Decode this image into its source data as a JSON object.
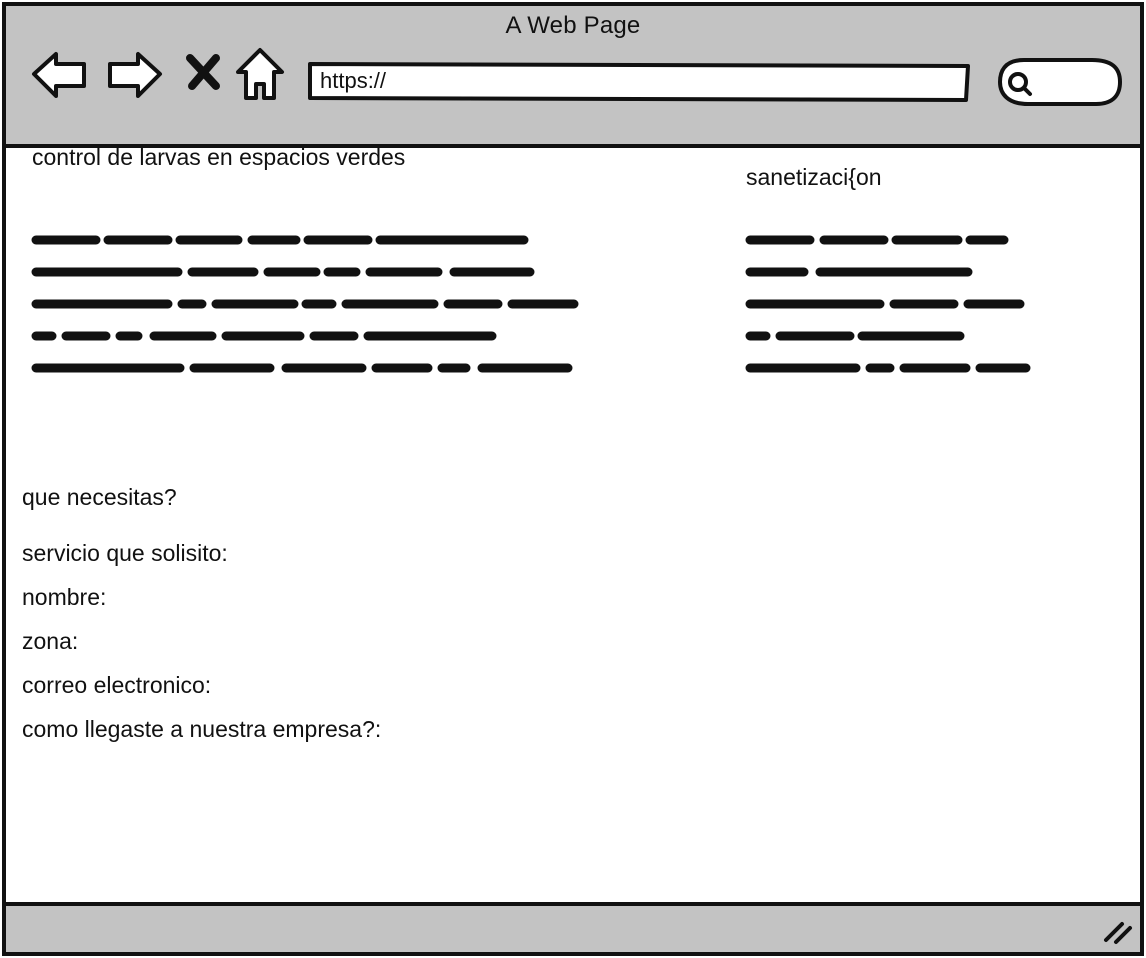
{
  "window": {
    "title": "A Web Page"
  },
  "toolbar": {
    "back_icon": "back-arrow-icon",
    "forward_icon": "forward-arrow-icon",
    "stop_icon": "close-x-icon",
    "home_icon": "home-icon",
    "search_icon": "search-icon"
  },
  "address_bar": {
    "value": "https://"
  },
  "main": {
    "left_heading": "control de larvas en espacios verdes",
    "right_heading": "sanetizaci{on"
  },
  "form": {
    "heading": "que necesitas?",
    "fields": [
      {
        "label": "servicio que solisito:"
      },
      {
        "label": "nombre:"
      },
      {
        "label": "zona:"
      },
      {
        "label": "correo electronico:"
      },
      {
        "label": "como llegaste a nuestra empresa?:"
      }
    ]
  },
  "colors": {
    "chrome_gray": "#c3c3c3",
    "ink": "#111111",
    "page": "#ffffff"
  }
}
